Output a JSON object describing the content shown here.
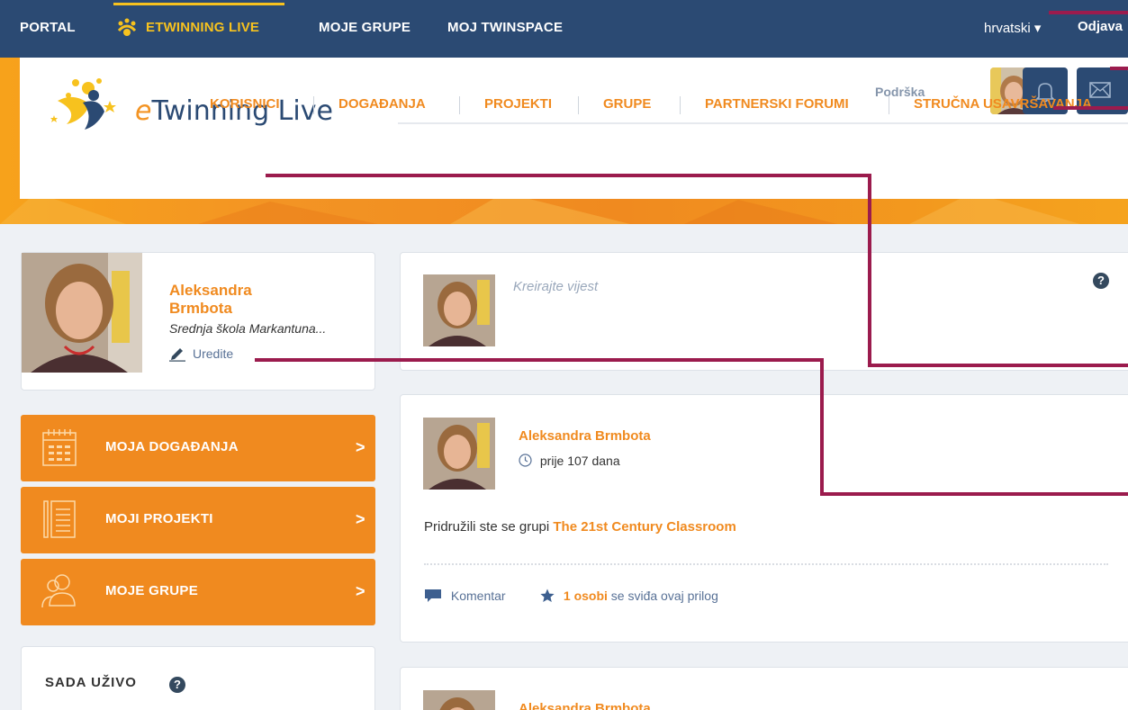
{
  "topbar": {
    "portal": "PORTAL",
    "etwinning_live": "ETWINNING LIVE",
    "my_groups": "MOJE GRUPE",
    "my_twinspace": "MOJ TWINSPACE",
    "language": "hrvatski ▾",
    "logout": "Odjava"
  },
  "header": {
    "logo_e": "e",
    "logo_rest": "Twinning Live",
    "support": "Podrška",
    "nav": [
      "KORISNICI",
      "DOGAĐANJA",
      "PROJEKTI",
      "GRUPE",
      "PARTNERSKI FORUMI",
      "STRUČNA USAVRŠAVANJA"
    ]
  },
  "profile": {
    "name_line1": "Aleksandra",
    "name_line2": "Brmbota",
    "school": "Srednja škola Markantuna...",
    "edit": "Uredite"
  },
  "sidebar": {
    "buttons": [
      {
        "label": "MOJA DOGAĐANJA",
        "icon": "calendar-icon"
      },
      {
        "label": "MOJI PROJEKTI",
        "icon": "document-icon"
      },
      {
        "label": "MOJE GRUPE",
        "icon": "users-icon"
      }
    ],
    "chevron": ">",
    "live_title": "SADA UŽIVO",
    "help": "?"
  },
  "composer": {
    "placeholder": "Kreirajte vijest",
    "help": "?"
  },
  "posts": [
    {
      "author": "Aleksandra Brmbota",
      "time": "prije 107 dana",
      "text_prefix": "Pridružili ste se grupi ",
      "text_link": "The 21st Century Classroom",
      "comment": "Komentar",
      "likes_highlight": "1 osobi",
      "likes_rest": " se sviđa ovaj prilog"
    },
    {
      "author": "Aleksandra Brmbota"
    }
  ],
  "colors": {
    "navy": "#2b4a73",
    "orange": "#f08a1f",
    "yellow": "#f7c21e",
    "callout": "#9b1b4d"
  }
}
